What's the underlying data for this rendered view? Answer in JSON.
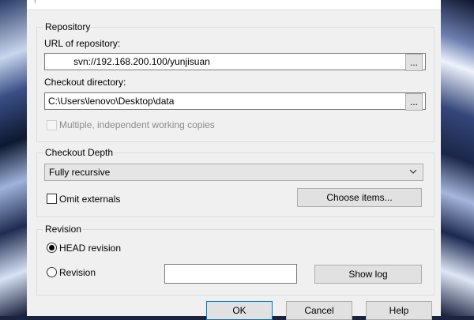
{
  "window": {
    "title_glyph": "↑"
  },
  "repository": {
    "group_label": "Repository",
    "url_label": "URL of repository:",
    "url_value": "svn://192.168.200.100/yunjisuan",
    "browse_label": "...",
    "checkout_dir_label": "Checkout directory:",
    "checkout_dir_value": "C:\\Users\\lenovo\\Desktop\\data",
    "browse_dir_label": "...",
    "multiple_copies_label": "Multiple, independent working copies"
  },
  "depth": {
    "group_label": "Checkout Depth",
    "selected": "Fully recursive",
    "omit_externals_label": "Omit externals",
    "choose_items_label": "Choose items..."
  },
  "revision": {
    "group_label": "Revision",
    "head_label": "HEAD revision",
    "revision_label": "Revision",
    "revision_value": "",
    "show_log_label": "Show log"
  },
  "buttons": {
    "ok": "OK",
    "cancel": "Cancel",
    "help": "Help"
  }
}
